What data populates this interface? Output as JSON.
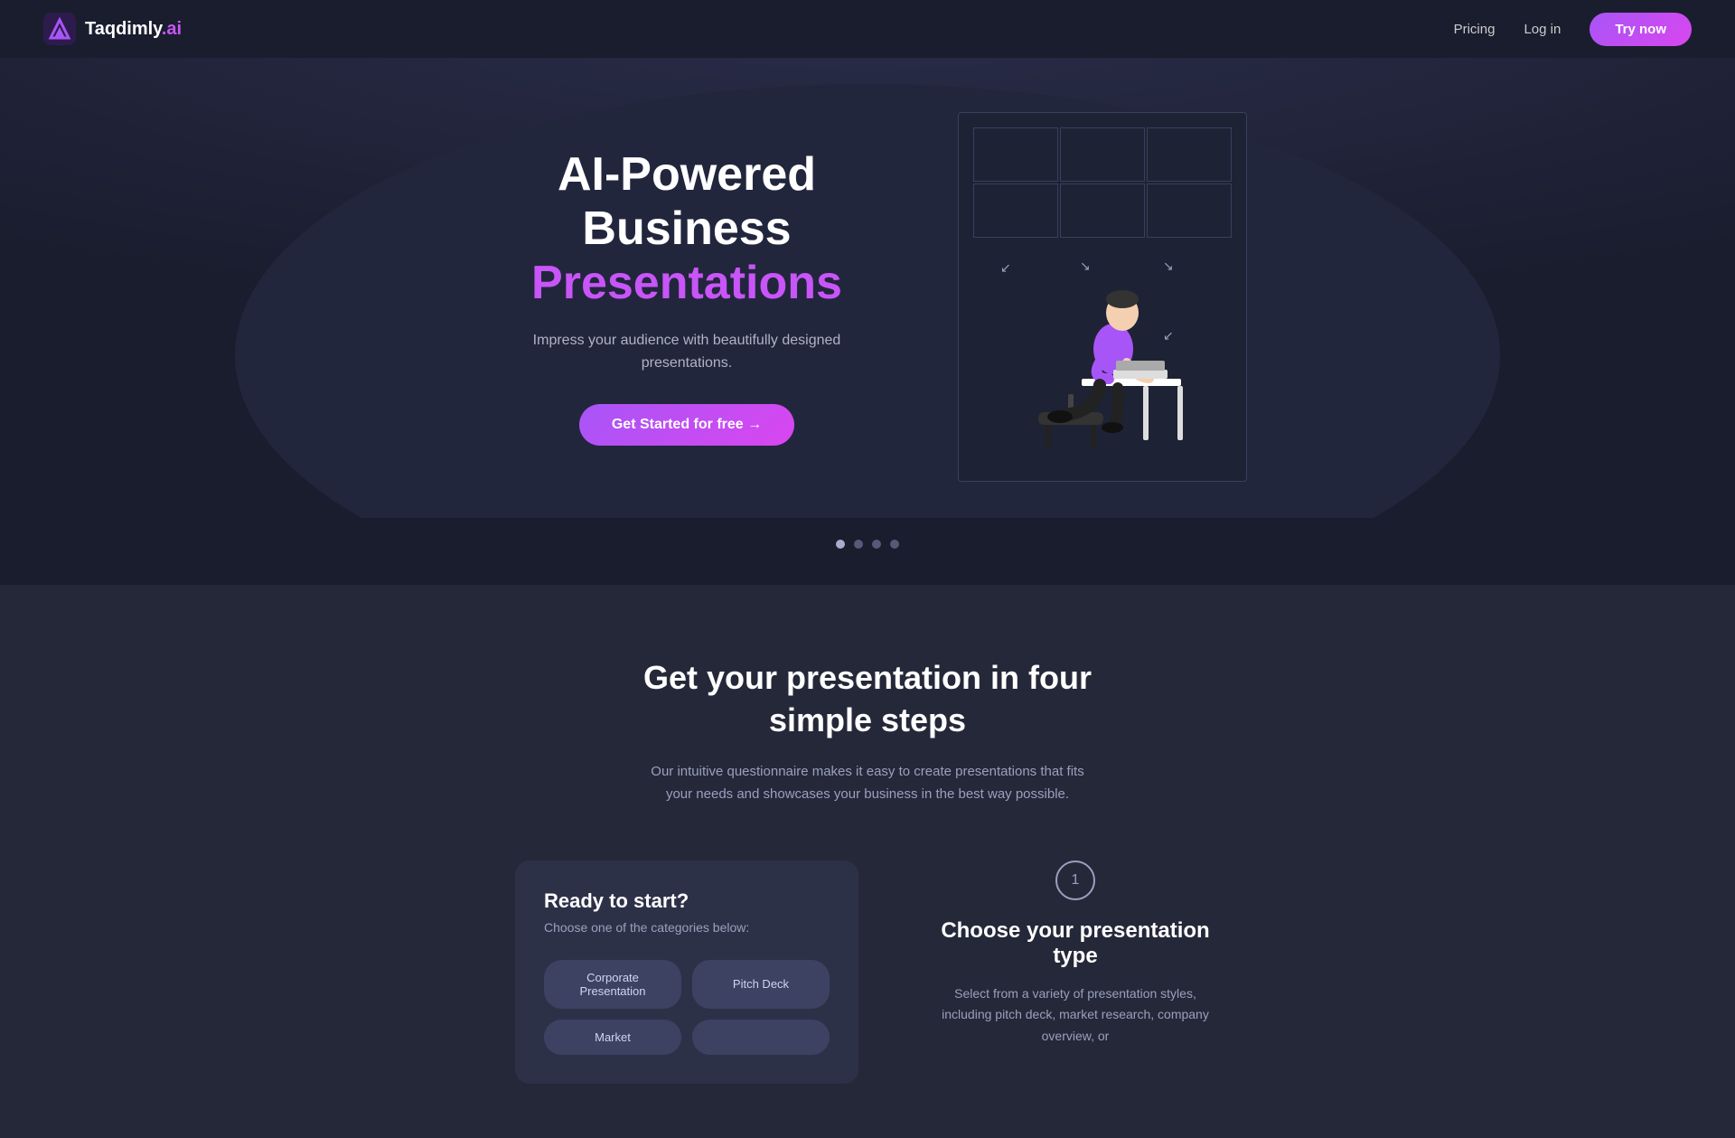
{
  "brand": {
    "name": "Taqdimly",
    "suffix": ".ai"
  },
  "nav": {
    "pricing_label": "Pricing",
    "login_label": "Log in",
    "try_label": "Try now"
  },
  "hero": {
    "title_line1": "AI-Powered",
    "title_line2": "Business",
    "title_accent": "Presentations",
    "subtitle": "Impress your audience with beautifully designed presentations.",
    "cta_label": "Get Started for free →"
  },
  "carousel": {
    "dots": [
      {
        "active": true
      },
      {
        "active": false
      },
      {
        "active": false
      },
      {
        "active": false
      }
    ]
  },
  "steps_section": {
    "title": "Get your presentation in four simple steps",
    "subtitle": "Our intuitive questionnaire makes it easy to create presentations that fits your needs and showcases your business in the best way possible.",
    "card": {
      "title": "Ready to start?",
      "description": "Choose one of the categories below:",
      "buttons": [
        "Corporate Presentation",
        "Pitch Deck",
        "Market",
        ""
      ]
    },
    "step1": {
      "number": "1",
      "name": "Choose your presentation type",
      "description": "Select from a variety of presentation styles, including pitch deck, market research, company overview, or"
    }
  },
  "colors": {
    "accent": "#c855f7",
    "accent2": "#d946ef",
    "background": "#1a1d2e",
    "surface": "#252839",
    "card": "#2d3148"
  }
}
